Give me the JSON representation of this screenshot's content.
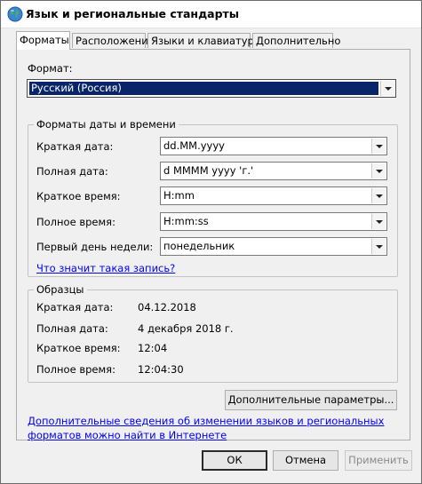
{
  "window": {
    "title": "Язык и региональные стандарты",
    "icon": "globe-icon"
  },
  "tabs": [
    "Форматы",
    "Расположение",
    "Языки и клавиатуры",
    "Дополнительно"
  ],
  "format": {
    "label": "Формат:",
    "value": "Русский (Россия)"
  },
  "datetime": {
    "title": "Форматы даты и времени",
    "rows": [
      {
        "label": "Краткая дата:",
        "value": "dd.MM.yyyy"
      },
      {
        "label": "Полная дата:",
        "value": "d MMMM yyyy 'г.'"
      },
      {
        "label": "Краткое время:",
        "value": "H:mm"
      },
      {
        "label": "Полное время:",
        "value": "H:mm:ss"
      },
      {
        "label": "Первый день недели:",
        "value": "понедельник"
      }
    ],
    "link": "Что значит такая запись?"
  },
  "samples": {
    "title": "Образцы",
    "rows": [
      {
        "label": "Краткая дата:",
        "value": "04.12.2018"
      },
      {
        "label": "Полная дата:",
        "value": "4 декабря 2018 г."
      },
      {
        "label": "Краткое время:",
        "value": "12:04"
      },
      {
        "label": "Полное время:",
        "value": "12:04:30"
      }
    ]
  },
  "advanced_button": "Дополнительные параметры...",
  "info_link": {
    "line1": "Дополнительные сведения об изменении языков и региональных",
    "line2": "форматов можно найти в Интернете"
  },
  "buttons": {
    "ok": "ОК",
    "cancel": "Отмена",
    "apply": "Применить"
  }
}
